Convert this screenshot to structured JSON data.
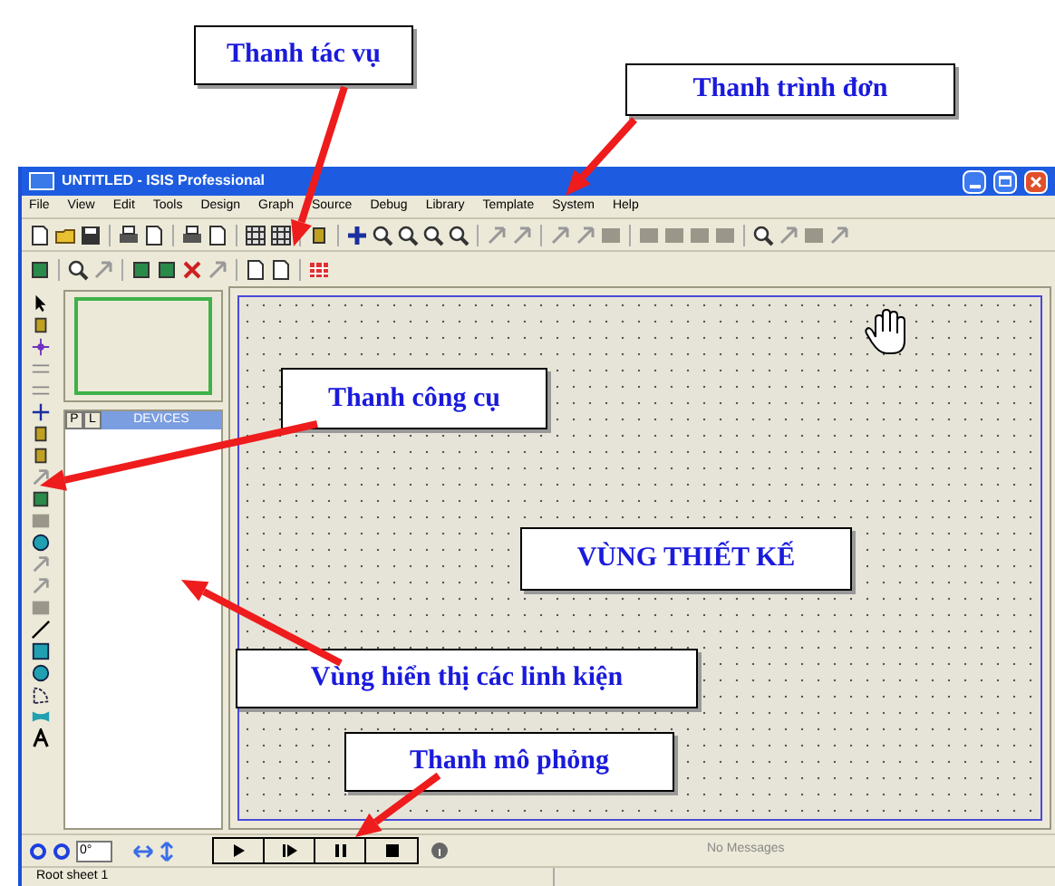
{
  "window": {
    "title": "UNTITLED - ISIS Professional"
  },
  "menu": [
    "File",
    "View",
    "Edit",
    "Tools",
    "Design",
    "Graph",
    "Source",
    "Debug",
    "Library",
    "Template",
    "System",
    "Help"
  ],
  "devices_panel": {
    "tabs": [
      "P",
      "L"
    ],
    "title": "DEVICES"
  },
  "rotation": {
    "value": "0°"
  },
  "simulation": {
    "message": "No Messages"
  },
  "status_bar": "Root sheet 1",
  "annotations": [
    {
      "text": "Thanh tác vụ",
      "arrow": true
    },
    {
      "text": "Thanh trình đơn",
      "arrow": true
    },
    {
      "text": "Thanh công cụ",
      "arrow": true
    },
    {
      "text": "VÙNG THIẾT KẾ",
      "arrow": false
    },
    {
      "text": "Vùng hiển thị các linh kiện",
      "arrow": true
    },
    {
      "text": "Thanh mô phỏng",
      "arrow": true
    }
  ]
}
